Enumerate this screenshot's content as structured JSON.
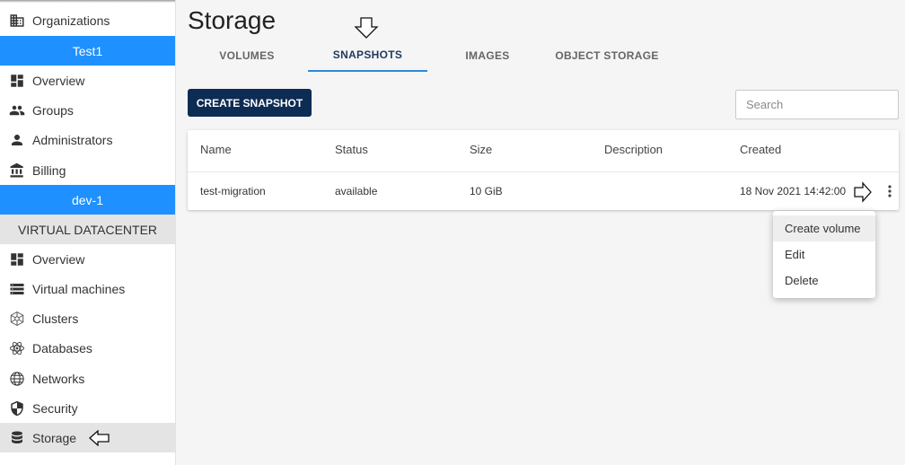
{
  "sidebar": {
    "organizations_label": "Organizations",
    "org_band": "Test1",
    "org_items": [
      {
        "label": "Overview",
        "icon": "dashboard-icon"
      },
      {
        "label": "Groups",
        "icon": "groups-icon"
      },
      {
        "label": "Administrators",
        "icon": "person-icon"
      },
      {
        "label": "Billing",
        "icon": "bank-icon"
      }
    ],
    "env_band": "dev-1",
    "section_header": "VIRTUAL DATACENTER",
    "vdc_items": [
      {
        "label": "Overview",
        "icon": "dashboard-icon"
      },
      {
        "label": "Virtual machines",
        "icon": "server-list-icon"
      },
      {
        "label": "Clusters",
        "icon": "cluster-icon"
      },
      {
        "label": "Databases",
        "icon": "atom-icon"
      },
      {
        "label": "Networks",
        "icon": "globe-icon"
      },
      {
        "label": "Security",
        "icon": "shield-icon"
      },
      {
        "label": "Storage",
        "icon": "database-icon",
        "active": true
      }
    ]
  },
  "main": {
    "title": "Storage",
    "tabs": [
      {
        "label": "VOLUMES"
      },
      {
        "label": "SNAPSHOTS",
        "active": true
      },
      {
        "label": "IMAGES"
      },
      {
        "label": "OBJECT STORAGE"
      }
    ],
    "create_button": "CREATE SNAPSHOT",
    "search_placeholder": "Search",
    "table": {
      "headers": [
        "Name",
        "Status",
        "Size",
        "Description",
        "Created"
      ],
      "rows": [
        [
          "test-migration",
          "available",
          "10 GiB",
          "",
          "18 Nov 2021 14:42:00"
        ]
      ]
    },
    "context_menu": [
      "Create volume",
      "Edit",
      "Delete"
    ]
  },
  "colors": {
    "accent_blue": "#1e90ff",
    "button_navy": "#0d2c54",
    "tab_underline": "#2c8ad8"
  }
}
